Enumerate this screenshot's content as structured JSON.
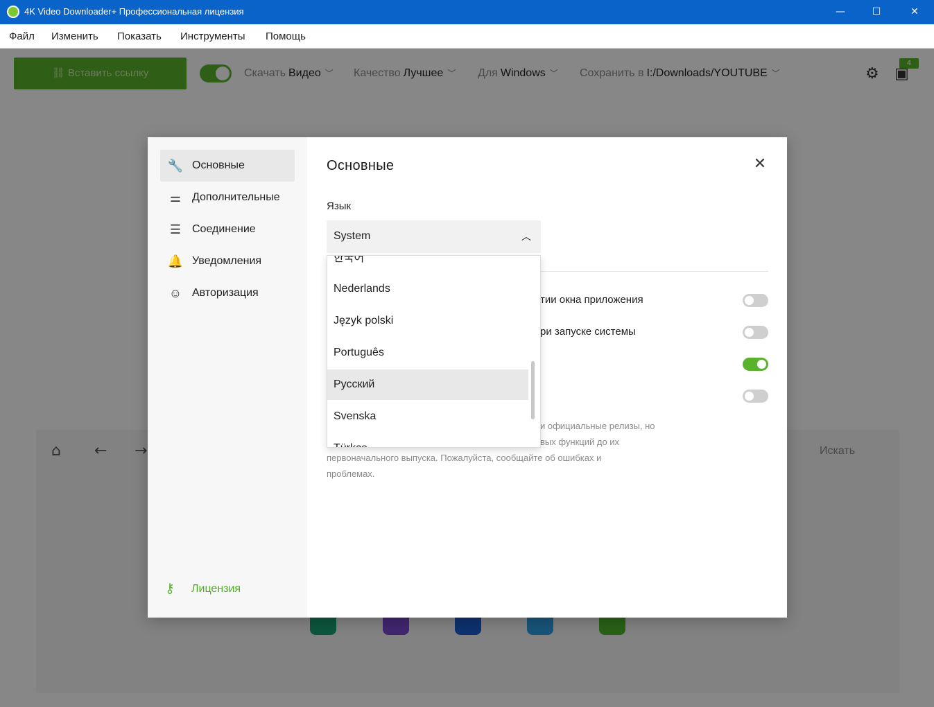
{
  "window": {
    "title": "4K Video Downloader+ Профессиональная лицензия",
    "minimize": "—",
    "maximize": "☐",
    "close": "✕"
  },
  "menu": [
    "Файл",
    "Изменить",
    "Показать",
    "Инструменты",
    "Помощь"
  ],
  "toolbar": {
    "paste_label": "Вставить ссылку",
    "download_label": "Скачать",
    "download_value": "Видео",
    "quality_label": "Качество",
    "quality_value": "Лучшее",
    "for_label": "Для",
    "for_value": "Windows",
    "save_label": "Сохранить в",
    "save_value": "I:/Downloads/YOUTUBE",
    "badge_count": "4"
  },
  "browser": {
    "search_label": "Искать"
  },
  "dialog": {
    "title": "Основные",
    "close": "✕",
    "sidebar": [
      {
        "label": "Основные",
        "icon": "wrench-icon"
      },
      {
        "label": "Дополнительные",
        "icon": "sliders-icon"
      },
      {
        "label": "Соединение",
        "icon": "server-icon"
      },
      {
        "label": "Уведомления",
        "icon": "bell-icon"
      },
      {
        "label": "Авторизация",
        "icon": "user-circle-icon"
      }
    ],
    "license_label": "Лицензия",
    "language": {
      "label": "Язык",
      "value": "System",
      "options": [
        "한국어",
        "Nederlands",
        "Język polski",
        "Português",
        "Русский",
        "Svenska",
        "Türkçe"
      ],
      "selected": "Русский"
    },
    "options": [
      {
        "text": "тии окна приложения",
        "on": false
      },
      {
        "text": "ри запуске системы",
        "on": false
      },
      {
        "text": "",
        "on": true
      },
      {
        "text": "",
        "on": false
      }
    ],
    "beta_desc_lines": [
      "и официальные релизы, но",
      "вых функций до их",
      "первоначального выпуска. Пожалуйста, сообщайте об ошибках и",
      "проблемах."
    ]
  },
  "colors": {
    "titlebar": "#0a63c9",
    "accent": "#59b22b"
  }
}
